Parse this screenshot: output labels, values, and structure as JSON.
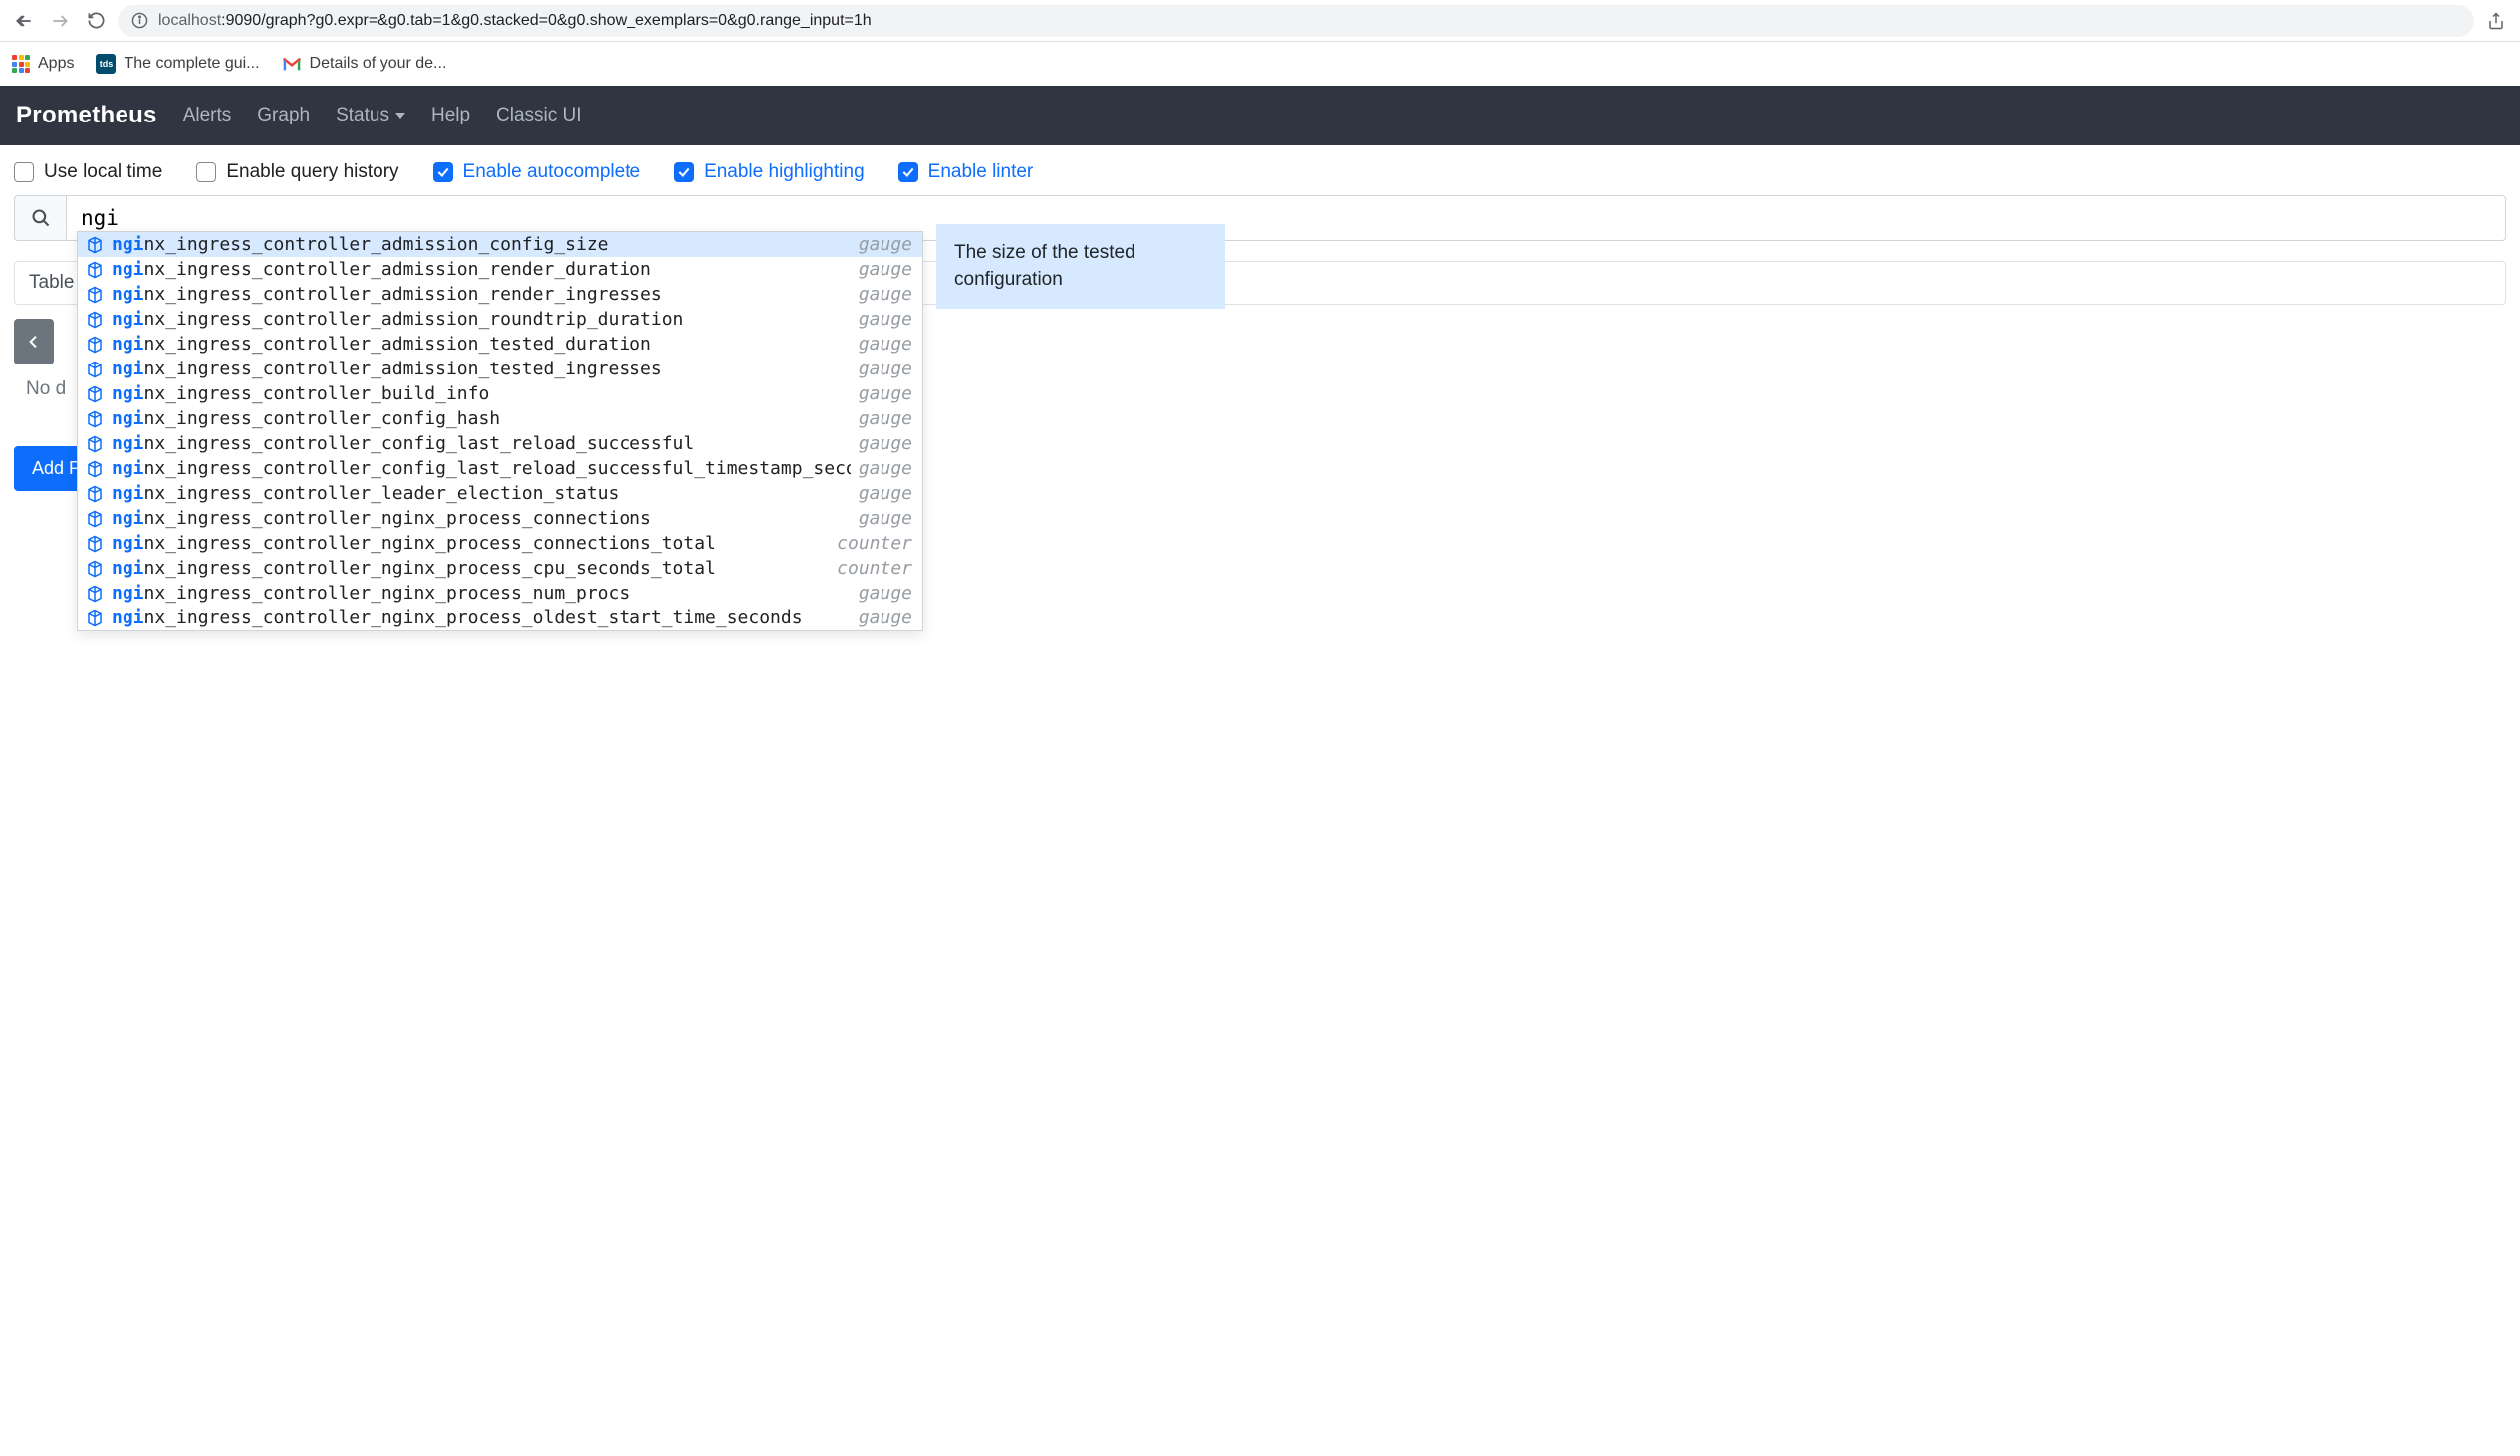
{
  "browser": {
    "url_dim": "localhost",
    "url_rest": ":9090/graph?g0.expr=&g0.tab=1&g0.stacked=0&g0.show_exemplars=0&g0.range_input=1h"
  },
  "bookmarks": {
    "apps": "Apps",
    "tds_label": "tds",
    "tds_text": "The complete gui...",
    "gmail_text": "Details of your de..."
  },
  "nav": {
    "brand": "Prometheus",
    "alerts": "Alerts",
    "graph": "Graph",
    "status": "Status",
    "help": "Help",
    "classic": "Classic UI"
  },
  "options": {
    "local_time": "Use local time",
    "query_history": "Enable query history",
    "autocomplete": "Enable autocomplete",
    "highlighting": "Enable highlighting",
    "linter": "Enable linter"
  },
  "query": {
    "input_value": "ngi"
  },
  "tabs": {
    "table": "Table"
  },
  "status": {
    "no_data": "No d"
  },
  "buttons": {
    "add_panel": "Add P"
  },
  "autocomplete": {
    "highlight_len": 3,
    "items": [
      {
        "name": "nginx_ingress_controller_admission_config_size",
        "type": "gauge",
        "selected": true
      },
      {
        "name": "nginx_ingress_controller_admission_render_duration",
        "type": "gauge"
      },
      {
        "name": "nginx_ingress_controller_admission_render_ingresses",
        "type": "gauge"
      },
      {
        "name": "nginx_ingress_controller_admission_roundtrip_duration",
        "type": "gauge"
      },
      {
        "name": "nginx_ingress_controller_admission_tested_duration",
        "type": "gauge"
      },
      {
        "name": "nginx_ingress_controller_admission_tested_ingresses",
        "type": "gauge"
      },
      {
        "name": "nginx_ingress_controller_build_info",
        "type": "gauge"
      },
      {
        "name": "nginx_ingress_controller_config_hash",
        "type": "gauge"
      },
      {
        "name": "nginx_ingress_controller_config_last_reload_successful",
        "type": "gauge"
      },
      {
        "name": "nginx_ingress_controller_config_last_reload_successful_timestamp_seconds",
        "type": "gauge"
      },
      {
        "name": "nginx_ingress_controller_leader_election_status",
        "type": "gauge"
      },
      {
        "name": "nginx_ingress_controller_nginx_process_connections",
        "type": "gauge"
      },
      {
        "name": "nginx_ingress_controller_nginx_process_connections_total",
        "type": "counter"
      },
      {
        "name": "nginx_ingress_controller_nginx_process_cpu_seconds_total",
        "type": "counter"
      },
      {
        "name": "nginx_ingress_controller_nginx_process_num_procs",
        "type": "gauge"
      },
      {
        "name": "nginx_ingress_controller_nginx_process_oldest_start_time_seconds",
        "type": "gauge"
      }
    ]
  },
  "tooltip": {
    "text": "The size of the tested configuration"
  }
}
